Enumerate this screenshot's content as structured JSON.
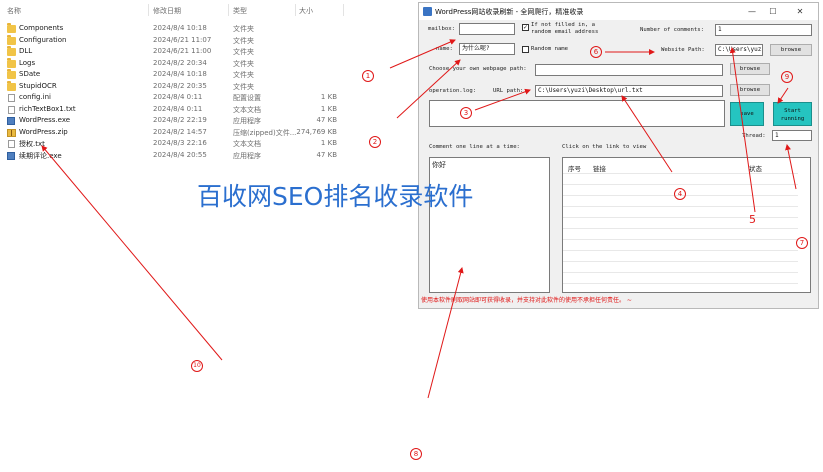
{
  "explorer": {
    "headers": {
      "name": "名称",
      "date": "修改日期",
      "type": "类型",
      "size": "大小"
    },
    "files": [
      {
        "icon": "folder",
        "name": "Components",
        "date": "2024/8/4 10:18",
        "type": "文件夹",
        "size": ""
      },
      {
        "icon": "folder",
        "name": "Configuration",
        "date": "2024/6/21 11:07",
        "type": "文件夹",
        "size": ""
      },
      {
        "icon": "folder",
        "name": "DLL",
        "date": "2024/6/21 11:00",
        "type": "文件夹",
        "size": ""
      },
      {
        "icon": "folder",
        "name": "Logs",
        "date": "2024/8/2 20:34",
        "type": "文件夹",
        "size": ""
      },
      {
        "icon": "folder",
        "name": "SDate",
        "date": "2024/8/4 10:18",
        "type": "文件夹",
        "size": ""
      },
      {
        "icon": "folder",
        "name": "StupidOCR",
        "date": "2024/8/2 20:35",
        "type": "文件夹",
        "size": ""
      },
      {
        "icon": "file",
        "name": "config.ini",
        "date": "2024/8/4 0:11",
        "type": "配置设置",
        "size": "1 KB"
      },
      {
        "icon": "file",
        "name": "richTextBox1.txt",
        "date": "2024/8/4 0:11",
        "type": "文本文档",
        "size": "1 KB"
      },
      {
        "icon": "exe",
        "name": "WordPress.exe",
        "date": "2024/8/2 22:19",
        "type": "应用程序",
        "size": "47 KB"
      },
      {
        "icon": "zip",
        "name": "WordPress.zip",
        "date": "2024/8/2 14:57",
        "type": "压缩(zipped)文件...",
        "size": "274,769 KB"
      },
      {
        "icon": "file",
        "name": "授权.txt",
        "date": "2024/8/3 22:16",
        "type": "文本文档",
        "size": "1 KB"
      },
      {
        "icon": "exe",
        "name": "续期评论.exe",
        "date": "2024/8/4 20:55",
        "type": "应用程序",
        "size": "47 KB"
      }
    ]
  },
  "app": {
    "title": "WordPress网站收录刷新 - 全网爬行，精准收录",
    "window_buttons": {
      "minimize": "—",
      "maximize": "☐",
      "close": "✕"
    },
    "mailbox_label": "mailbox:",
    "mailbox_value": "",
    "email_checkbox_checked": true,
    "email_checkbox_label_line1": "If not filled in, a",
    "email_checkbox_label_line2": "random email address",
    "comments_label": "Number of comments:",
    "comments_value": "1",
    "name_label": "name:",
    "name_value": "为什么呢?",
    "random_name_checked": false,
    "random_name_label": "Random name",
    "website_path_label": "Website Path:",
    "website_path_value": "C:\\Users\\yuzi",
    "browse_label": "browse",
    "webpage_path_label": "Choose your own webpage path:",
    "webpage_path_value": "",
    "operation_log_label": "operation.log:",
    "url_path_label": "URL path:",
    "url_path_value": "C:\\Users\\yuzi\\Desktop\\url.txt",
    "save_label": "save",
    "start_label_line1": "Start",
    "start_label_line2": "running",
    "thread_label": "Thread:",
    "thread_value": "1",
    "comment_panel_label": "Comment one line at a time:",
    "comment_text": "你好",
    "link_panel_label": "Click on the link to view",
    "grid_headers": {
      "index": "序号",
      "link": "链接",
      "status": "状态"
    },
    "status_text": "使用本软件刷取网站即可获得收录，并支持对此软件的使用不承担任何责任。 ~"
  },
  "annotations": {
    "watermark": "百收网SEO排名收录软件",
    "markers": [
      "1",
      "2",
      "3",
      "4",
      "5",
      "6",
      "7",
      "8",
      "9",
      "10"
    ]
  },
  "colors": {
    "accent_teal": "#25c4c0",
    "annotation_red": "#e01818",
    "watermark_blue": "#2b6fcf"
  }
}
